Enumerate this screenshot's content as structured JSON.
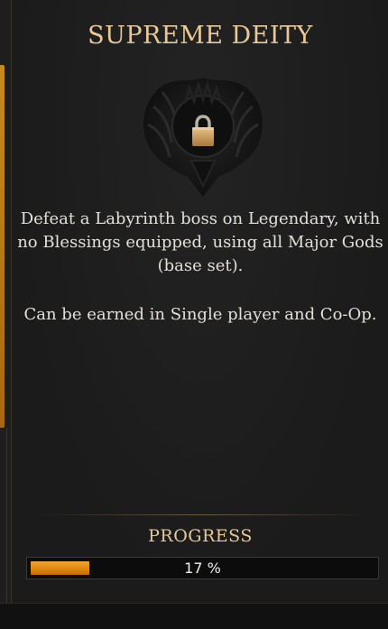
{
  "achievement": {
    "title": "SUPREME DEITY",
    "status_icon": "lock-icon",
    "emblem_icon": "winged-crest-icon",
    "description": "Defeat a Labyrinth boss on Legendary, with no Blessings equipped, using all Major Gods (base set).",
    "availability": "Can be earned in Single player and Co-Op."
  },
  "progress": {
    "label": "PROGRESS",
    "value": 17,
    "text": "17 %"
  },
  "colors": {
    "title": "#e9c898",
    "body_text": "#e4e0d8",
    "progress_fill": "#e08712",
    "rail_accent": "#c8891e",
    "background": "#1b1b1b"
  }
}
